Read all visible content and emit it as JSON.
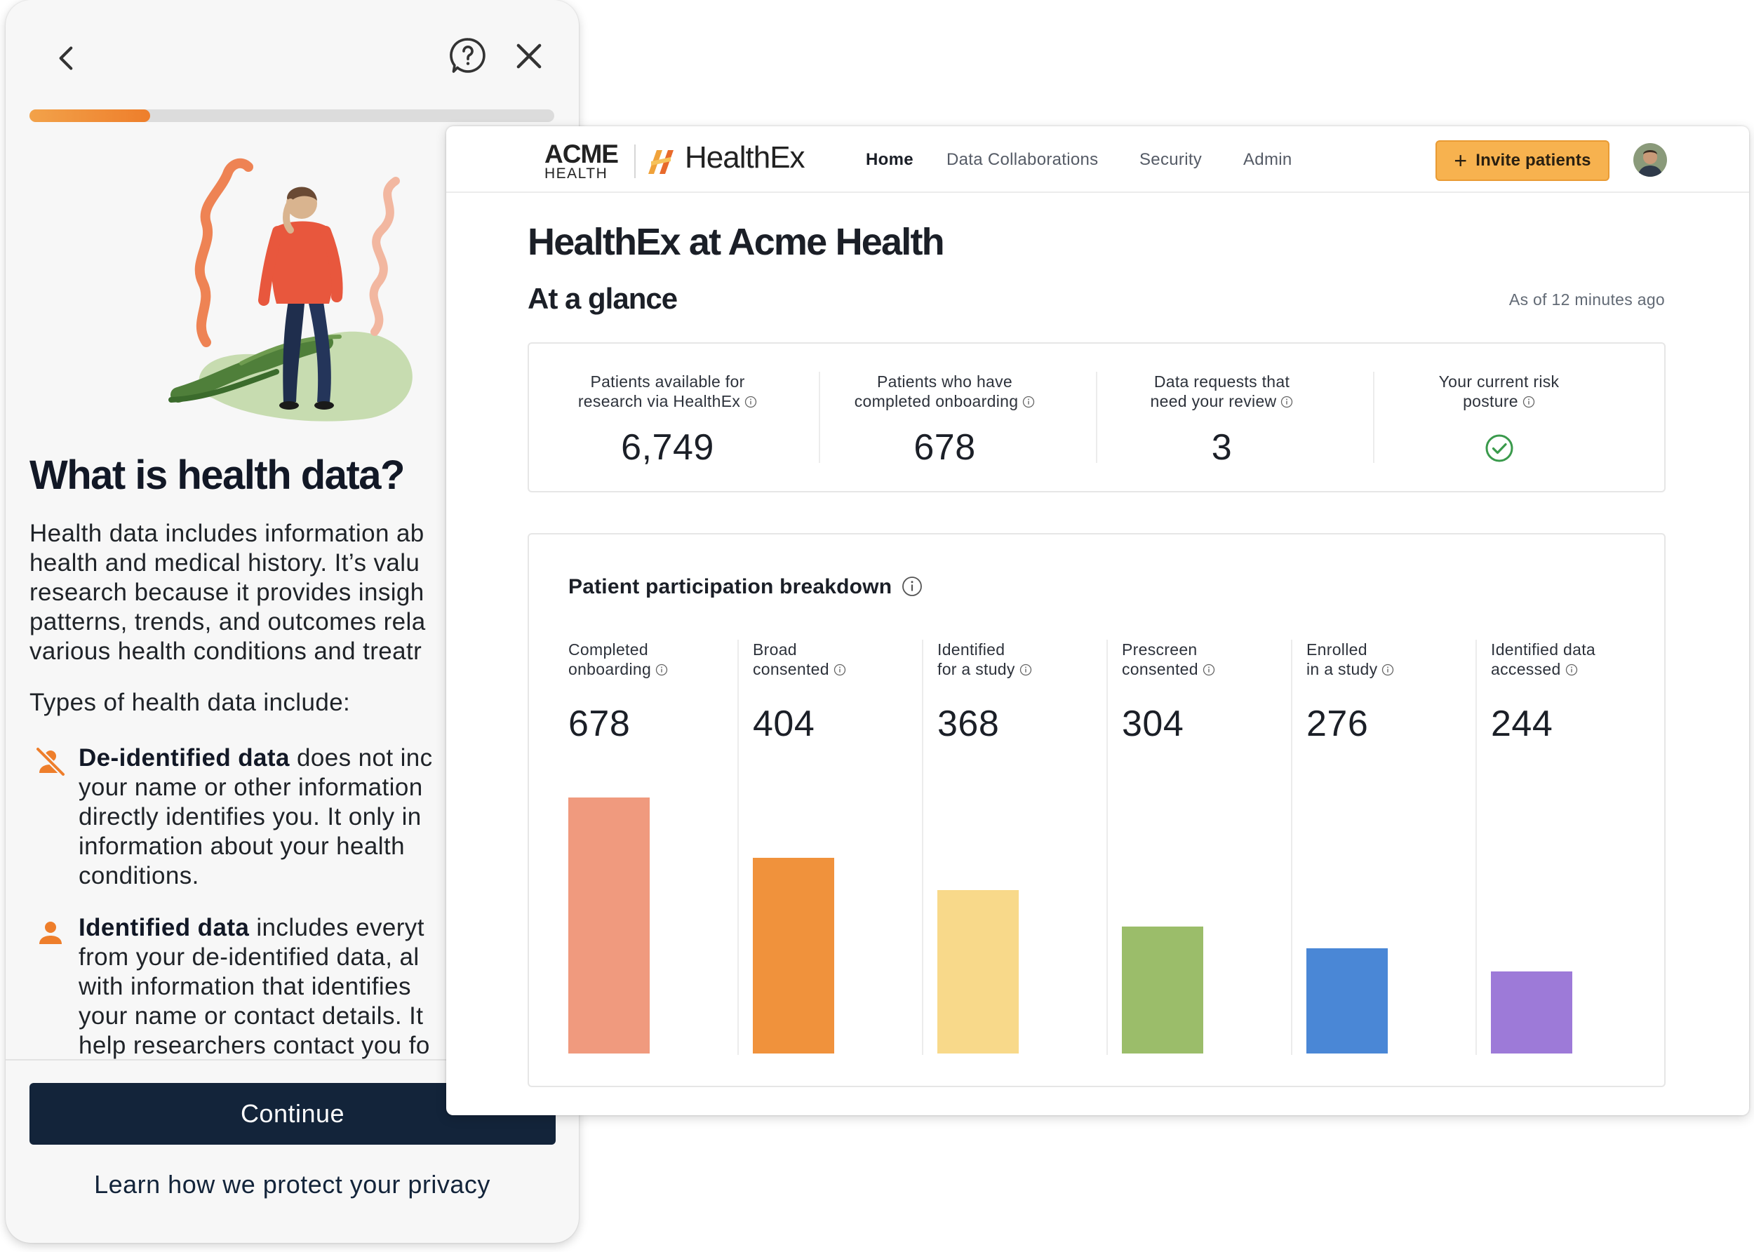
{
  "mobile": {
    "progress": 0.23,
    "title": "What is health data?",
    "body": "Health data includes information ab health and medical history. It’s valu research because it provides insigh patterns, trends, and outcomes rela various health conditions and treatr",
    "body_lines": [
      "Health data includes information ab",
      "health and medical history. It’s valu",
      "research because it provides insigh",
      "patterns, trends, and outcomes rela",
      "various health conditions and treatr"
    ],
    "types_heading": "Types of health data include:",
    "items": [
      {
        "icon": "person-off-icon",
        "bold": "De-identified data",
        "lines": [
          " does not inc",
          "your name or other information",
          "directly identifies you. It only in",
          "information about your health",
          "conditions."
        ]
      },
      {
        "icon": "person-icon",
        "bold": "Identified data",
        "lines": [
          " includes everyt",
          "from your de-identified data, al",
          "with information that identifies",
          "your name or contact details. It",
          "help researchers contact you fo"
        ]
      }
    ],
    "continue_label": "Continue",
    "privacy_link": "Learn how we protect your privacy",
    "accent_color": "#ee7e2b",
    "primary_color": "#13243a"
  },
  "desktop": {
    "logo_acme_top": "ACME",
    "logo_acme_bottom": "HEALTH",
    "logo_healthex": "HealthEx",
    "nav": [
      "Home",
      "Data Collaborations",
      "Security",
      "Admin"
    ],
    "nav_active": "Home",
    "invite_label": "Invite patients",
    "page_title": "HealthEx at Acme Health",
    "glance_title": "At a glance",
    "as_of": "As of 12 minutes ago",
    "glance": [
      {
        "label_lines": [
          "Patients available for",
          "research via HealthEx"
        ],
        "value": "6,749"
      },
      {
        "label_lines": [
          "Patients who have",
          "completed onboarding"
        ],
        "value": "678"
      },
      {
        "label_lines": [
          "Data requests that",
          "need your review"
        ],
        "value": "3"
      },
      {
        "label_lines": [
          "Your current risk",
          "posture"
        ],
        "value": "",
        "status_icon": "check-circle-icon",
        "status_color": "#3a9a4c"
      }
    ],
    "breakdown_title": "Patient participation breakdown",
    "brand_orange": "#f7b24f"
  },
  "chart_data": {
    "type": "bar",
    "title": "Patient participation breakdown",
    "categories": [
      "Completed onboarding",
      "Broad consented",
      "Identified for a study",
      "Prescreen consented",
      "Enrolled in a study",
      "Identified data accessed"
    ],
    "label_lines": [
      [
        "Completed",
        "onboarding"
      ],
      [
        "Broad",
        "consented"
      ],
      [
        "Identified",
        "for a study"
      ],
      [
        "Prescreen",
        "consented"
      ],
      [
        "Enrolled",
        "in a study"
      ],
      [
        "Identified data",
        "accessed"
      ]
    ],
    "values": [
      678,
      404,
      368,
      304,
      276,
      244
    ],
    "colors": [
      "#f09a7e",
      "#f0923c",
      "#f8d98a",
      "#9bbd6a",
      "#4a87d6",
      "#9d7ad8"
    ],
    "bar_heights_relative": [
      1.0,
      0.765,
      0.638,
      0.497,
      0.41,
      0.32
    ],
    "grid": false,
    "legend": "none"
  }
}
